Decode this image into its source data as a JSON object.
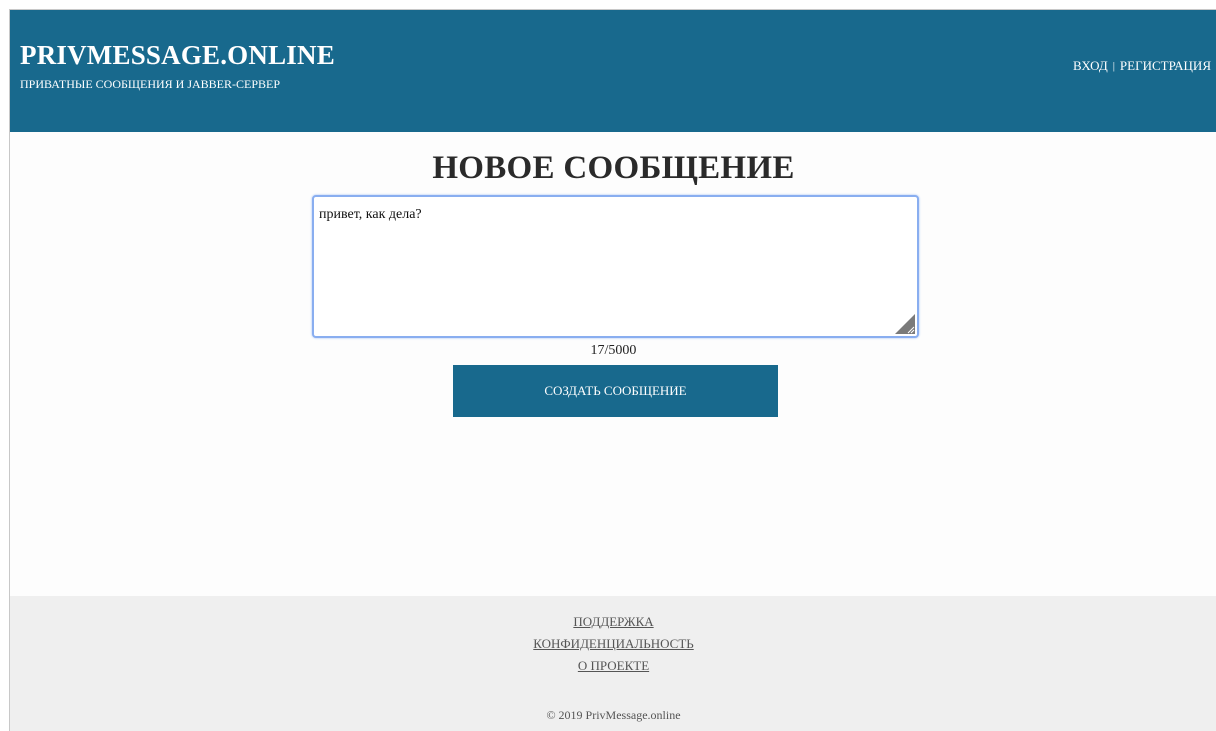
{
  "header": {
    "site_title": "PRIVMESSAGE.ONLINE",
    "site_subtitle": "ПРИВАТНЫЕ СООБЩЕНИЯ И JABBER-СЕРВЕР",
    "login_label": "ВХОД",
    "separator": "|",
    "register_label": "РЕГИСТРАЦИЯ"
  },
  "main": {
    "title": "НОВОЕ СООБЩЕНИЕ",
    "message_value": "привет, как дела?",
    "char_counter": "17/5000",
    "submit_label": "СОЗДАТЬ СООБЩЕНИЕ"
  },
  "footer": {
    "links": [
      "ПОДДЕРЖКА",
      "КОНФИДЕНЦИАЛЬНОСТЬ",
      "О ПРОЕКТЕ"
    ],
    "copyright": "© 2019 PrivMessage.online"
  },
  "icons": {
    "resize_grip": "resize-grip-icon"
  },
  "colors": {
    "brand": "#18698d",
    "focus_border": "#89aef0",
    "footer_bg": "#efefef"
  }
}
